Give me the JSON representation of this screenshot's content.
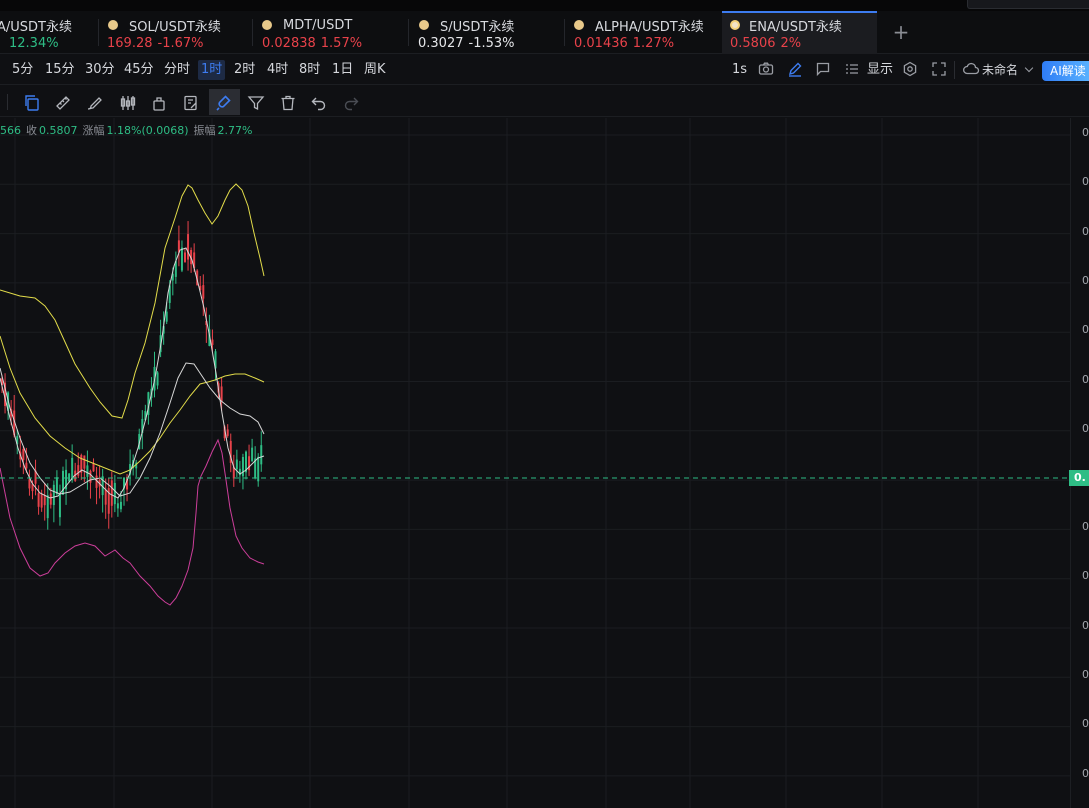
{
  "tabs": [
    {
      "name": "A/USDT永续",
      "price": "12.34%",
      "change": "",
      "price_color": "#2ebd85",
      "change_color": "#2ebd85"
    },
    {
      "name": "SOL/USDT永续",
      "price": "169.28",
      "change": "-1.67%",
      "price_color": "#e8424a",
      "change_color": "#e8424a"
    },
    {
      "name": "MDT/USDT",
      "price": "0.02838",
      "change": "1.57%",
      "price_color": "#e8424a",
      "change_color": "#e8424a"
    },
    {
      "name": "S/USDT永续",
      "price": "0.3027",
      "change": "-1.53%",
      "price_color": "#e6e7ea",
      "change_color": "#e6e7ea"
    },
    {
      "name": "ALPHA/USDT永续",
      "price": "0.01436",
      "change": "1.27%",
      "price_color": "#e8424a",
      "change_color": "#e8424a"
    },
    {
      "name": "ENA/USDT永续",
      "price": "0.5806",
      "change": "2%",
      "price_color": "#e8424a",
      "change_color": "#e8424a",
      "active": true
    }
  ],
  "intervals": [
    "5分",
    "15分",
    "30分",
    "45分",
    "分时",
    "1时",
    "2时",
    "4时",
    "8时",
    "1日",
    "周K"
  ],
  "active_interval": "1时",
  "right_controls": {
    "seconds": "1s",
    "display": "显示",
    "layout_name": "未命名",
    "ai_label": "AI解读"
  },
  "legend": {
    "prefix": "566",
    "close_label": "收",
    "close_value": "0.5807",
    "change_label": "涨幅",
    "change_value": "1.18%(0.0068)",
    "amplitude_label": "振幅",
    "amplitude_value": "2.77%"
  },
  "price_axis": {
    "tick_labels": [
      "0",
      "0",
      "0",
      "0",
      "0",
      "0",
      "0",
      "0",
      "0",
      "0",
      "0",
      "0",
      "0",
      "0"
    ],
    "current_price_label": "0."
  },
  "colors": {
    "up": "#2ebd85",
    "down": "#e8424a",
    "accent": "#3d7cf0",
    "ma_white": "#d7d7d7",
    "ma_yellow": "#e2dc4a",
    "ma_pink": "#cc3e9a"
  }
}
